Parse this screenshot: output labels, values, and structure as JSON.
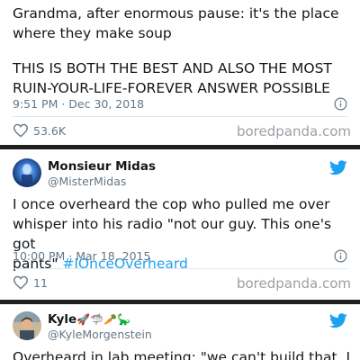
{
  "tweet1": {
    "text_line1": "Grandma, after enormous pause: it's the place",
    "text_line2": "where they make soup",
    "caps_line1": "THIS IS BOTH THE BEST AND ALSO THE MOST",
    "caps_line2": "RUIN-YOUR-LIFE-FOREVER ANSWER POSSIBLE",
    "timestamp": "9:51 PM · Dec 30, 2018",
    "likes": "53.6K",
    "watermark": "boredpanda.com"
  },
  "tweet2": {
    "name": "Monsieur Midas",
    "handle": "@MisterMidas",
    "text_line1": "I once overheard the cop who pulled me over",
    "text_line2": "whisper into his radio \"not our guy. This one's got",
    "text_line3_prefix": "pants\" ",
    "hashtag": "#IOnceOverheard",
    "timestamp": "10:00 PM · Mar 18, 2015",
    "likes": "11",
    "watermark": "boredpanda.com"
  },
  "tweet3": {
    "name": "Kyle",
    "name_emojis": "🚀🦈🥕🦕",
    "handle": "@KyleMorgenstein",
    "text_line1": "Overheard in lab meeting: \"we can't build that. I"
  },
  "icons": {
    "info": "info-icon",
    "heart": "heart-icon",
    "twitter": "twitter-bird-icon"
  },
  "colors": {
    "twitter_blue": "#1da1f2",
    "meta_gray": "#657786",
    "separator": "#1f1f1f"
  }
}
